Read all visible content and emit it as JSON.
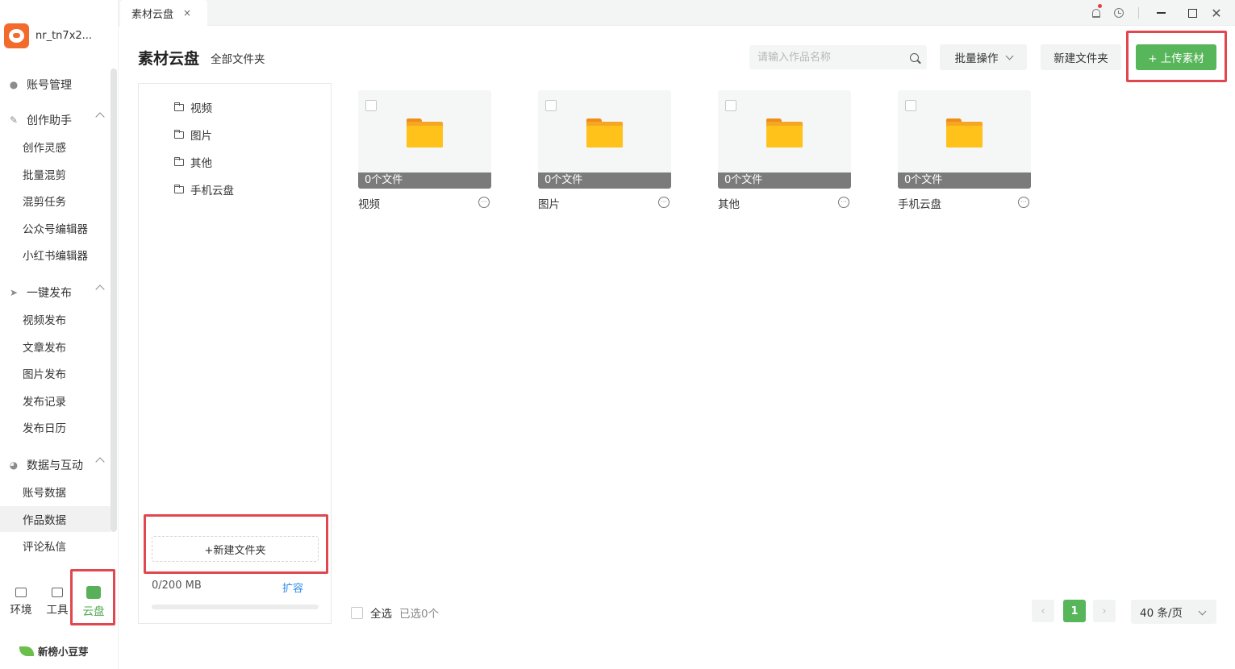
{
  "colors": {
    "accent": "#57b55a",
    "highlight_box": "#e0474e",
    "folder_yellow": "#ffc21a",
    "link_blue": "#2d8ce8"
  },
  "user": {
    "name": "nr_tn7x2..."
  },
  "sidebar": {
    "account": {
      "label": "账号管理",
      "icon": "user-icon"
    },
    "sections": [
      {
        "label": "创作助手",
        "icon": "pen-icon",
        "items": [
          "创作灵感",
          "批量混剪",
          "混剪任务",
          "公众号编辑器",
          "小红书编辑器"
        ]
      },
      {
        "label": "一键发布",
        "icon": "send-icon",
        "items": [
          "视频发布",
          "文章发布",
          "图片发布",
          "发布记录",
          "发布日历"
        ]
      },
      {
        "label": "数据与互动",
        "icon": "pie-chart-icon",
        "items": [
          "账号数据",
          "作品数据",
          "评论私信"
        ]
      }
    ],
    "active_item": "作品数据",
    "bottom_tabs": [
      {
        "label": "环境",
        "icon": "monitor-icon"
      },
      {
        "label": "工具",
        "icon": "toolbox-icon"
      },
      {
        "label": "云盘",
        "icon": "cloud-drive-icon"
      }
    ],
    "active_bottom_tab": "云盘",
    "brand": "新榜小豆芽"
  },
  "tabbar": {
    "tabs": [
      {
        "label": "素材云盘",
        "close": "×"
      }
    ]
  },
  "header": {
    "title": "素材云盘",
    "subtitle": "全部文件夹",
    "search_placeholder": "请输入作品名称",
    "batch_button": "批量操作",
    "new_folder_button": "新建文件夹",
    "upload_button": "+ 上传素材"
  },
  "tree": {
    "folders": [
      "视频",
      "图片",
      "其他",
      "手机云盘"
    ],
    "new_folder_button": "+新建文件夹",
    "storage": "0/200 MB",
    "storage_used_fraction": 0,
    "expand_link": "扩容"
  },
  "cards": [
    {
      "name": "视频",
      "count": "0个文件"
    },
    {
      "name": "图片",
      "count": "0个文件"
    },
    {
      "name": "其他",
      "count": "0个文件"
    },
    {
      "name": "手机云盘",
      "count": "0个文件"
    }
  ],
  "footer": {
    "select_all": "全选",
    "selected": "已选0个",
    "pagination": {
      "prev": "‹",
      "current": "1",
      "next": "›",
      "page_size": "40 条/页"
    }
  }
}
